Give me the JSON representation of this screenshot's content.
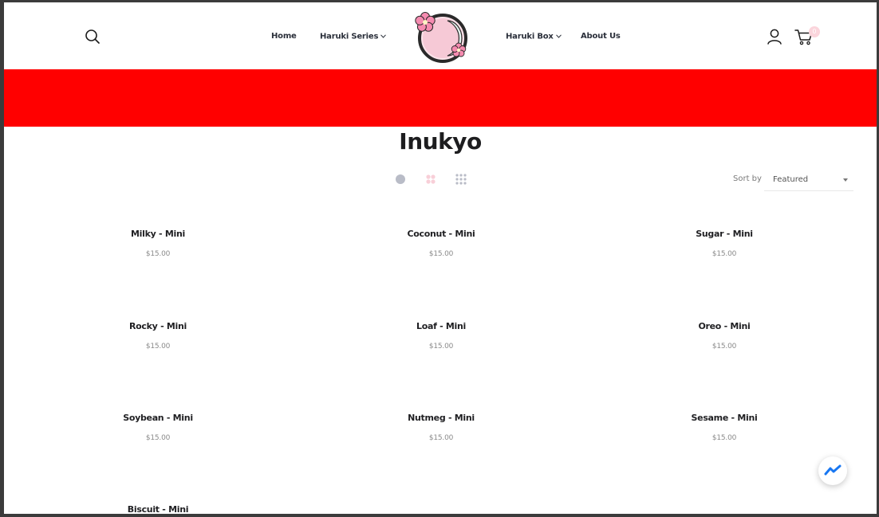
{
  "header": {
    "nav": [
      {
        "label": "Home",
        "has_dropdown": false
      },
      {
        "label": "Haruki Series",
        "has_dropdown": true
      },
      {
        "label": "Haruki Box",
        "has_dropdown": true
      },
      {
        "label": "About Us",
        "has_dropdown": false
      }
    ],
    "cart_count": "0",
    "icons": [
      "search-icon",
      "logo",
      "account-icon",
      "cart-icon"
    ]
  },
  "banner": {
    "color": "#ff0000"
  },
  "collection": {
    "title": "Inukyo",
    "view_options": [
      "grid-1-icon",
      "grid-2-icon",
      "grid-3-icon"
    ],
    "sort": {
      "label": "Sort by",
      "value": "Featured"
    }
  },
  "products": [
    {
      "name": "Milky - Mini",
      "price": "$15.00"
    },
    {
      "name": "Coconut - Mini",
      "price": "$15.00"
    },
    {
      "name": "Sugar - Mini",
      "price": "$15.00"
    },
    {
      "name": "Rocky - Mini",
      "price": "$15.00"
    },
    {
      "name": "Loaf - Mini",
      "price": "$15.00"
    },
    {
      "name": "Oreo - Mini",
      "price": "$15.00"
    },
    {
      "name": "Soybean - Mini",
      "price": "$15.00"
    },
    {
      "name": "Nutmeg - Mini",
      "price": "$15.00"
    },
    {
      "name": "Sesame - Mini",
      "price": "$15.00"
    },
    {
      "name": "Biscuit - Mini",
      "price": ""
    }
  ],
  "colors": {
    "accent": "#ff0000",
    "text": "#1f1f22",
    "price": "#8a8a8a",
    "cart_badge": "#fbd5dc",
    "messenger": "#1877f2"
  }
}
